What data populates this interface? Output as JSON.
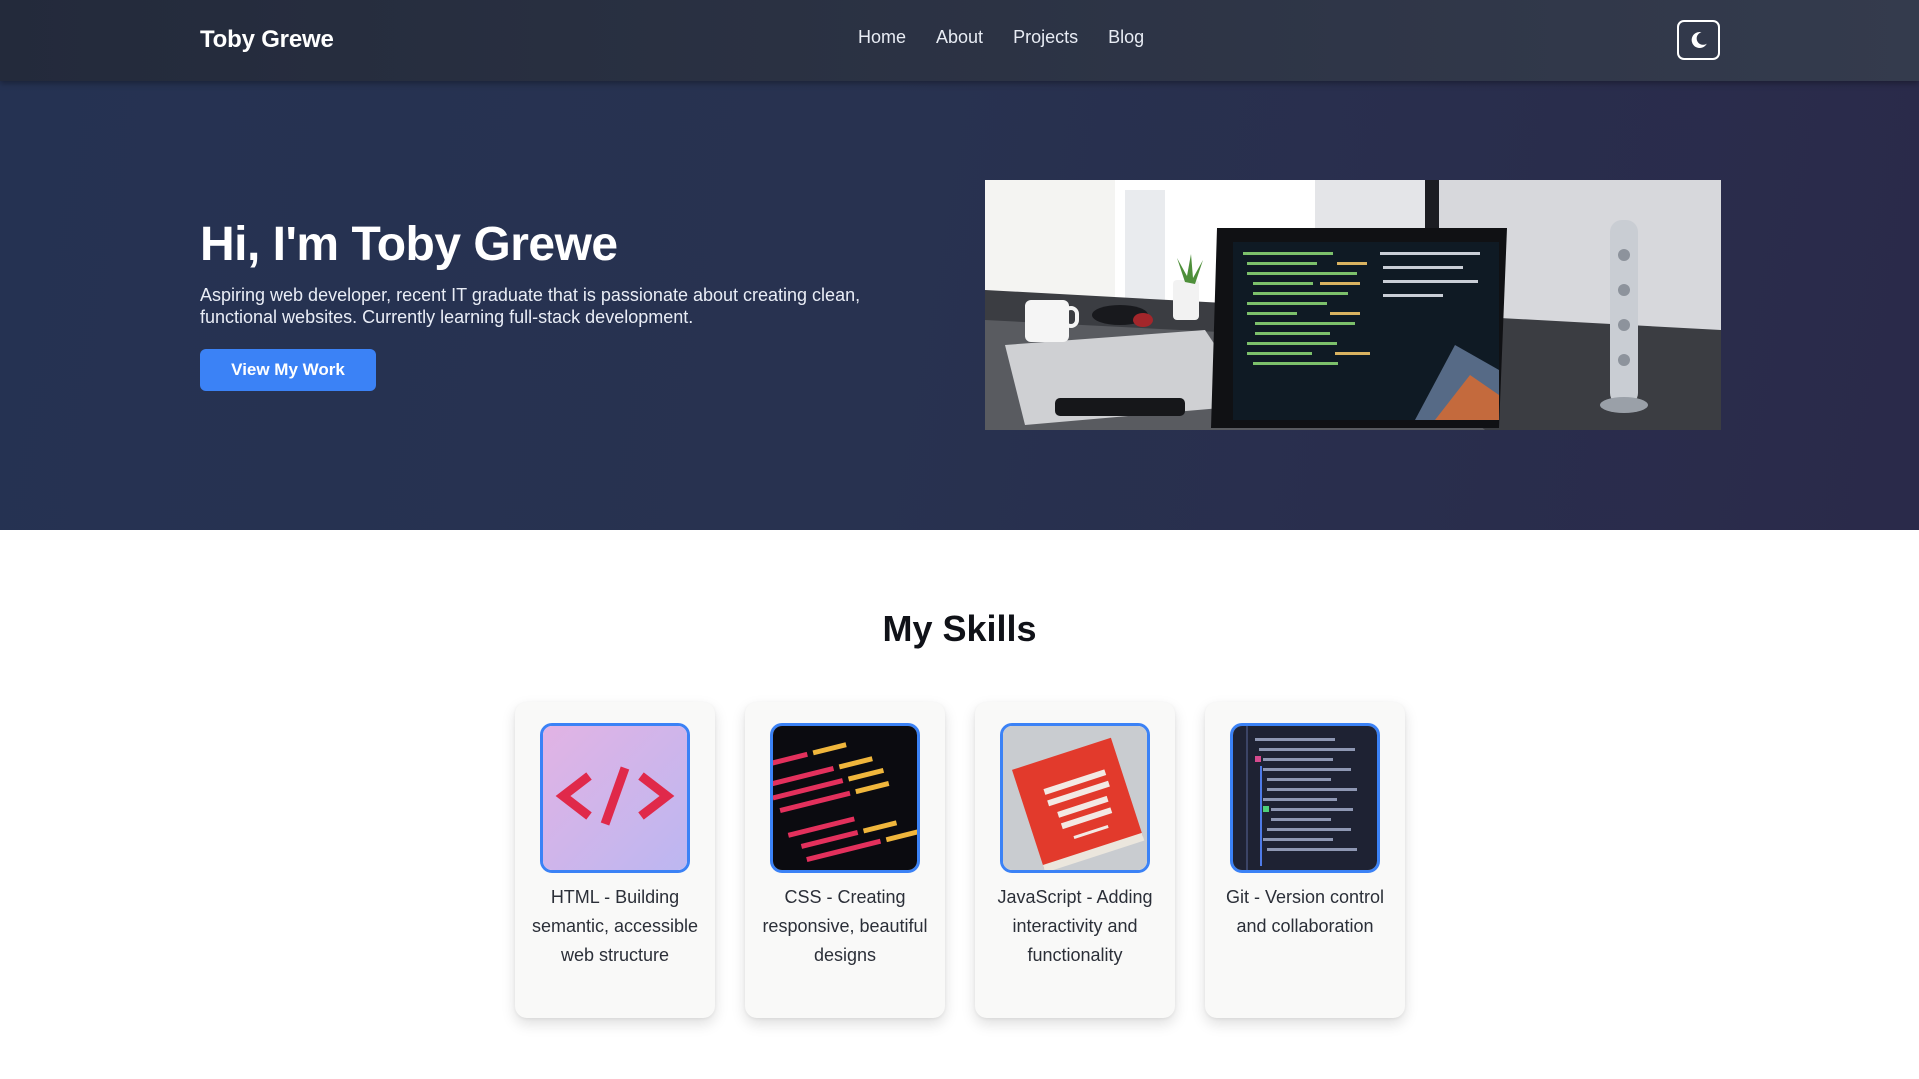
{
  "nav": {
    "brand": "Toby Grewe",
    "links": [
      {
        "label": "Home"
      },
      {
        "label": "About"
      },
      {
        "label": "Projects"
      },
      {
        "label": "Blog"
      }
    ],
    "theme_toggle_icon": "moon-icon"
  },
  "hero": {
    "title": "Hi, I'm Toby Grewe",
    "subtitle": "Aspiring web developer, recent IT graduate that is passionate about creating clean, functional websites. Currently learning full-stack development.",
    "cta_label": "View My Work",
    "image_icon": "laptop-code-photo"
  },
  "skills": {
    "title": "My Skills",
    "items": [
      {
        "text": "HTML - Building semantic, accessible web structure",
        "icon": "html-tag-icon"
      },
      {
        "text": "CSS - Creating responsive, beautiful designs",
        "icon": "css-code-icon"
      },
      {
        "text": "JavaScript - Adding interactivity and functionality",
        "icon": "javascript-book-icon"
      },
      {
        "text": "Git - Version control and collaboration",
        "icon": "git-code-icon"
      }
    ]
  },
  "colors": {
    "accent": "#3b82f6",
    "nav_bg": "#2a3142",
    "hero_bg": "#273150",
    "card_bg": "#f9f9f8"
  }
}
